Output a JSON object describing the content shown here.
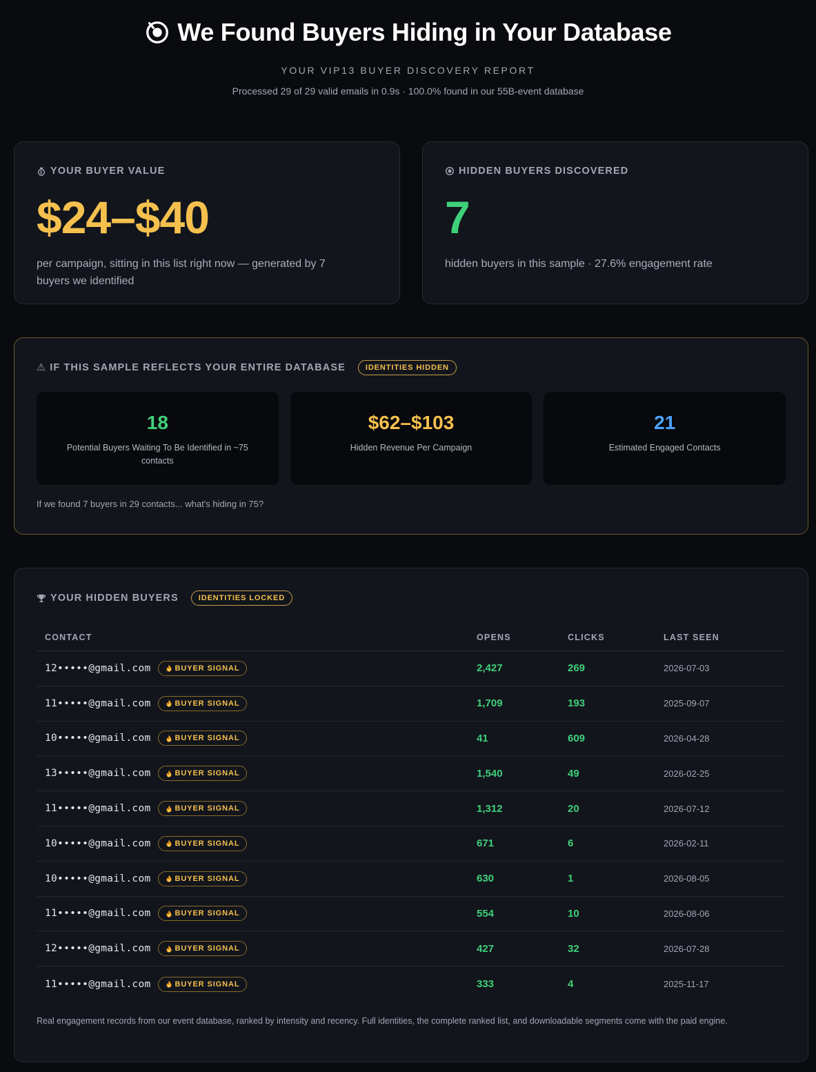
{
  "header": {
    "title": "We Found Buyers Hiding in Your Database",
    "subtitle": "YOUR VIP13 BUYER DISCOVERY REPORT",
    "meta": "Processed 29 of 29 valid emails in 0.9s · 100.0% found in our 55B-event database",
    "icon": "target-icon"
  },
  "value_card": {
    "label": "YOUR BUYER VALUE",
    "icon": "money-bag-icon",
    "value": "$24–$40",
    "description": "per campaign, sitting in this list right now — generated by 7 buyers we identified"
  },
  "hidden_card": {
    "label": "HIDDEN BUYERS DISCOVERED",
    "icon": "target-icon",
    "value": "7",
    "description": "hidden buyers in this sample · 27.6% engagement rate"
  },
  "reflect_card": {
    "label": "⚠ IF THIS SAMPLE REFLECTS YOUR ENTIRE DATABASE",
    "badge": "IDENTITIES HIDDEN",
    "stats": [
      {
        "value": "18",
        "label": "Potential Buyers Waiting To Be Identified in ~75 contacts",
        "color": "#3fd07a"
      },
      {
        "value": "$62–$103",
        "label": "Hidden Revenue Per Campaign",
        "color": "#f5c04e"
      },
      {
        "value": "21",
        "label": "Estimated Engaged Contacts",
        "color": "#4aa3ff"
      }
    ],
    "footer": "If we found 7 buyers in 29 contacts... what's hiding in 75?"
  },
  "buyers_card": {
    "label": "YOUR HIDDEN BUYERS",
    "icon": "trophy-icon",
    "badge": "IDENTITIES LOCKED",
    "columns": {
      "contact": "CONTACT",
      "opens": "OPENS",
      "clicks": "CLICKS",
      "last_seen": "LAST SEEN"
    },
    "signal_label": "BUYER SIGNAL",
    "signal_icon": "fire-icon",
    "rows": [
      {
        "email": "12•••••@gmail.com",
        "opens": "2,427",
        "clicks": "269",
        "last_seen": "2026-07-03"
      },
      {
        "email": "11•••••@gmail.com",
        "opens": "1,709",
        "clicks": "193",
        "last_seen": "2025-09-07"
      },
      {
        "email": "10•••••@gmail.com",
        "opens": "41",
        "clicks": "609",
        "last_seen": "2026-04-28"
      },
      {
        "email": "13•••••@gmail.com",
        "opens": "1,540",
        "clicks": "49",
        "last_seen": "2026-02-25"
      },
      {
        "email": "11•••••@gmail.com",
        "opens": "1,312",
        "clicks": "20",
        "last_seen": "2026-07-12"
      },
      {
        "email": "10•••••@gmail.com",
        "opens": "671",
        "clicks": "6",
        "last_seen": "2026-02-11"
      },
      {
        "email": "10•••••@gmail.com",
        "opens": "630",
        "clicks": "1",
        "last_seen": "2026-08-05"
      },
      {
        "email": "11•••••@gmail.com",
        "opens": "554",
        "clicks": "10",
        "last_seen": "2026-08-06"
      },
      {
        "email": "12•••••@gmail.com",
        "opens": "427",
        "clicks": "32",
        "last_seen": "2026-07-28"
      },
      {
        "email": "11•••••@gmail.com",
        "opens": "333",
        "clicks": "4",
        "last_seen": "2025-11-17"
      }
    ],
    "footer": "Real engagement records from our event database, ranked by intensity and recency. Full identities, the complete ranked list, and downloadable segments come with the paid engine."
  }
}
